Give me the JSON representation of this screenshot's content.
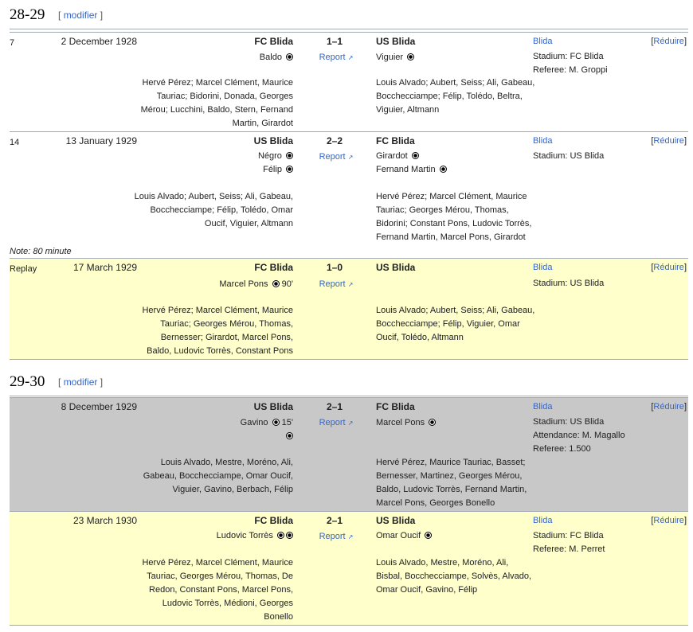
{
  "sections": [
    {
      "title": "28-29",
      "edit": "modifier"
    },
    {
      "title": "29-30",
      "edit": "modifier"
    }
  ],
  "edit_bracket_open": "[",
  "edit_bracket_close": "]",
  "collapse_label": "Réduire",
  "report_label": "Report",
  "location": "Blida",
  "matches": [
    {
      "round": "7",
      "date": "2 December 1928",
      "home": "FC Blida",
      "score": "1–1",
      "away": "US Blida",
      "home_scorers": [
        {
          "name": "Baldo",
          "balls": 1,
          "minute": ""
        }
      ],
      "away_scorers": [
        {
          "name": "Viguier",
          "balls": 1,
          "minute": ""
        }
      ],
      "info": [
        "Stadium: FC Blida",
        "Referee: M. Groppi"
      ],
      "home_lineup": "Hervé Pérez; Marcel Clément, Maurice Tauriac; Bidorini, Donada, Georges Mérou; Lucchini, Baldo, Stern, Fernand Martin, Girardot",
      "away_lineup": "Louis Alvado; Aubert, Seiss; Ali, Gabeau, Bocchecciampe; Félip, Tolédo, Beltra, Viguier, Altmann"
    },
    {
      "round": "14",
      "date": "13 January 1929",
      "home": "US Blida",
      "score": "2–2",
      "away": "FC Blida",
      "home_scorers": [
        {
          "name": "Négro",
          "balls": 1,
          "minute": ""
        },
        {
          "name": "Félip",
          "balls": 1,
          "minute": ""
        }
      ],
      "away_scorers": [
        {
          "name": "Girardot",
          "balls": 1,
          "minute": ""
        },
        {
          "name": "Fernand Martin",
          "balls": 1,
          "minute": ""
        }
      ],
      "info": [
        "Stadium: US Blida"
      ],
      "home_lineup": "Louis Alvado; Aubert, Seiss; Ali, Gabeau, Bocchecciampe; Félip, Tolédo, Omar Oucif, Viguier, Altmann",
      "away_lineup": "Hervé Pérez; Marcel Clément, Maurice Tauriac; Georges Mérou, Thomas, Bidorini; Constant Pons, Ludovic Torrès, Fernand Martin, Marcel Pons, Girardot",
      "note": "Note: 80 minute"
    },
    {
      "round": "Replay",
      "date": "17 March 1929",
      "home": "FC Blida",
      "score": "1–0",
      "away": "US Blida",
      "home_scorers": [
        {
          "name": "Marcel Pons",
          "balls": 1,
          "minute": "90'"
        }
      ],
      "away_scorers": [],
      "info": [
        "Stadium: US Blida"
      ],
      "home_lineup": "Hervé Pérez; Marcel Clément, Maurice Tauriac; Georges Mérou, Thomas, Bernesser; Girardot, Marcel Pons, Baldo, Ludovic Torrès, Constant Pons",
      "away_lineup": "Louis Alvado; Aubert, Seiss; Ali, Gabeau, Bocchecciampe; Félip, Viguier, Omar Oucif, Tolédo, Altmann"
    },
    {
      "round": "",
      "date": "8 December 1929",
      "home": "US Blida",
      "score": "2–1",
      "away": "FC Blida",
      "home_scorers": [
        {
          "name": "Gavino",
          "balls": 1,
          "minute": "15'"
        }
      ],
      "away_scorers": [
        {
          "name": "Marcel Pons",
          "balls": 1,
          "minute": ""
        }
      ],
      "info": [
        "Stadium: US Blida",
        "Attendance: M. Magallo",
        "Referee: 1.500"
      ],
      "home_lineup": "Louis Alvado, Mestre, Moréno, Ali, Gabeau, Bocchecciampe, Omar Oucif, Viguier, Gavino, Berbach, Félip",
      "away_lineup": "Hervé Pérez, Maurice Tauriac, Basset; Bernesser, Martinez, Georges Mérou, Baldo, Ludovic Torrès, Fernand Martin, Marcel Pons, Georges Bonello"
    },
    {
      "round": "",
      "date": "23 March 1930",
      "home": "FC Blida",
      "score": "2–1",
      "away": "US Blida",
      "home_scorers": [
        {
          "name": "Ludovic Torrès",
          "balls": 2,
          "minute": ""
        }
      ],
      "away_scorers": [
        {
          "name": "Omar Oucif",
          "balls": 1,
          "minute": ""
        }
      ],
      "info": [
        "Stadium: FC Blida",
        "Referee: M. Perret"
      ],
      "home_lineup": "Hervé Pérez, Marcel Clément, Maurice Tauriac, Georges Mérou, Thomas, De Redon, Constant Pons, Marcel Pons, Ludovic Torrès, Médioni, Georges Bonello",
      "away_lineup": "Louis Alvado, Mestre, Moréno, Ali, Bisbal, Bocchecciampe, Solvès, Alvado, Omar Oucif, Gavino, Félip"
    }
  ]
}
